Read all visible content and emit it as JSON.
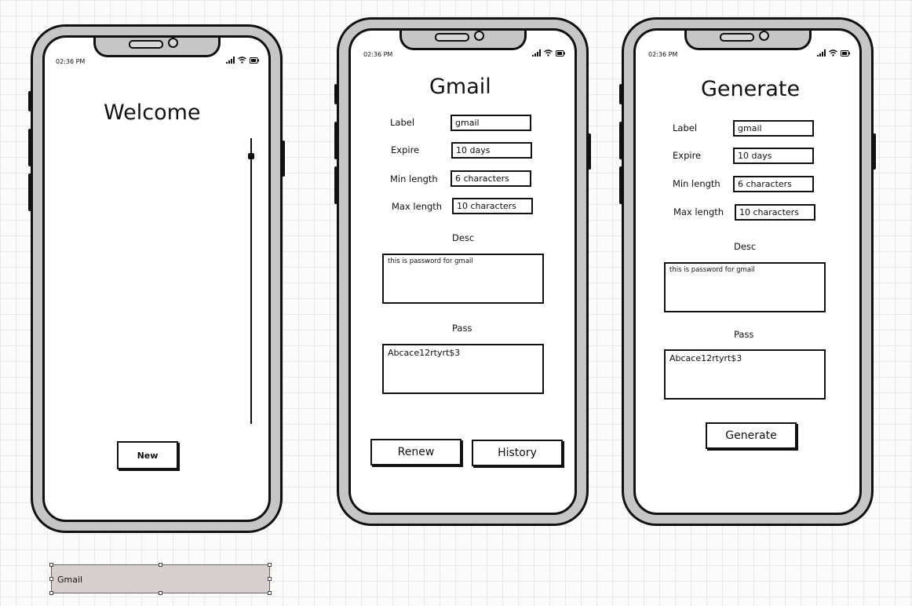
{
  "phones": {
    "welcome": {
      "status_time": "02:36 PM",
      "title": "Welcome",
      "new_button": "New",
      "scroll_level": 0.06
    },
    "gmail": {
      "status_time": "02:36 PM",
      "title": "Gmail",
      "label": {
        "label": "Label",
        "value": "gmail"
      },
      "expire": {
        "label": "Expire",
        "value": "10 days"
      },
      "min_length": {
        "label": "Min length",
        "value": "6 characters"
      },
      "max_length": {
        "label": "Max length",
        "value": "10 characters"
      },
      "desc": {
        "label": "Desc",
        "value": "this  is  password for gmail"
      },
      "pass": {
        "label": "Pass",
        "value": "Abcace12rtyrt$3"
      },
      "renew_button": "Renew",
      "history_button": "History"
    },
    "generate": {
      "status_time": "02:36 PM",
      "title": "Generate",
      "label": {
        "label": "Label",
        "value": "gmail"
      },
      "expire": {
        "label": "Expire",
        "value": "10 days"
      },
      "min_length": {
        "label": "Min length",
        "value": "6 characters"
      },
      "max_length": {
        "label": "Max length",
        "value": "10 characters"
      },
      "desc": {
        "label": "Desc",
        "value": "this  is  password for gmail"
      },
      "pass": {
        "label": "Pass",
        "value": "Abcace12rtyrt$3"
      },
      "generate_button": "Generate"
    }
  },
  "selected_item": {
    "text": "Gmail"
  },
  "icons": [
    "signal-icon",
    "wifi-icon",
    "battery-icon"
  ],
  "colors": {
    "shell": "#c6c6c6",
    "outline": "#111111",
    "selection": "#d7cfcd"
  }
}
